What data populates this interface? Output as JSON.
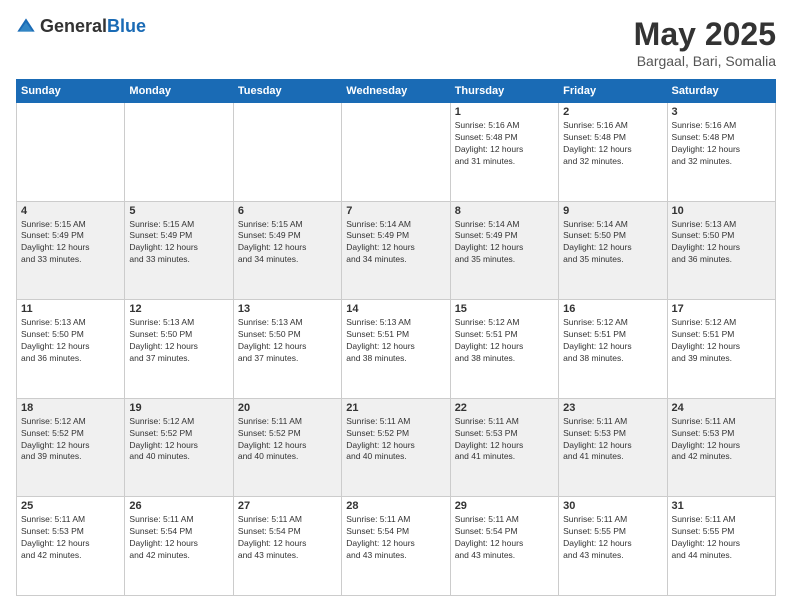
{
  "header": {
    "logo": {
      "general": "General",
      "blue": "Blue"
    },
    "title": "May 2025",
    "location": "Bargaal, Bari, Somalia"
  },
  "calendar": {
    "days_of_week": [
      "Sunday",
      "Monday",
      "Tuesday",
      "Wednesday",
      "Thursday",
      "Friday",
      "Saturday"
    ],
    "weeks": [
      {
        "row_class": "row-odd",
        "days": [
          {
            "number": "",
            "text": ""
          },
          {
            "number": "",
            "text": ""
          },
          {
            "number": "",
            "text": ""
          },
          {
            "number": "",
            "text": ""
          },
          {
            "number": "1",
            "text": "Sunrise: 5:16 AM\nSunset: 5:48 PM\nDaylight: 12 hours\nand 31 minutes."
          },
          {
            "number": "2",
            "text": "Sunrise: 5:16 AM\nSunset: 5:48 PM\nDaylight: 12 hours\nand 32 minutes."
          },
          {
            "number": "3",
            "text": "Sunrise: 5:16 AM\nSunset: 5:48 PM\nDaylight: 12 hours\nand 32 minutes."
          }
        ]
      },
      {
        "row_class": "row-even",
        "days": [
          {
            "number": "4",
            "text": "Sunrise: 5:15 AM\nSunset: 5:49 PM\nDaylight: 12 hours\nand 33 minutes."
          },
          {
            "number": "5",
            "text": "Sunrise: 5:15 AM\nSunset: 5:49 PM\nDaylight: 12 hours\nand 33 minutes."
          },
          {
            "number": "6",
            "text": "Sunrise: 5:15 AM\nSunset: 5:49 PM\nDaylight: 12 hours\nand 34 minutes."
          },
          {
            "number": "7",
            "text": "Sunrise: 5:14 AM\nSunset: 5:49 PM\nDaylight: 12 hours\nand 34 minutes."
          },
          {
            "number": "8",
            "text": "Sunrise: 5:14 AM\nSunset: 5:49 PM\nDaylight: 12 hours\nand 35 minutes."
          },
          {
            "number": "9",
            "text": "Sunrise: 5:14 AM\nSunset: 5:50 PM\nDaylight: 12 hours\nand 35 minutes."
          },
          {
            "number": "10",
            "text": "Sunrise: 5:13 AM\nSunset: 5:50 PM\nDaylight: 12 hours\nand 36 minutes."
          }
        ]
      },
      {
        "row_class": "row-odd",
        "days": [
          {
            "number": "11",
            "text": "Sunrise: 5:13 AM\nSunset: 5:50 PM\nDaylight: 12 hours\nand 36 minutes."
          },
          {
            "number": "12",
            "text": "Sunrise: 5:13 AM\nSunset: 5:50 PM\nDaylight: 12 hours\nand 37 minutes."
          },
          {
            "number": "13",
            "text": "Sunrise: 5:13 AM\nSunset: 5:50 PM\nDaylight: 12 hours\nand 37 minutes."
          },
          {
            "number": "14",
            "text": "Sunrise: 5:13 AM\nSunset: 5:51 PM\nDaylight: 12 hours\nand 38 minutes."
          },
          {
            "number": "15",
            "text": "Sunrise: 5:12 AM\nSunset: 5:51 PM\nDaylight: 12 hours\nand 38 minutes."
          },
          {
            "number": "16",
            "text": "Sunrise: 5:12 AM\nSunset: 5:51 PM\nDaylight: 12 hours\nand 38 minutes."
          },
          {
            "number": "17",
            "text": "Sunrise: 5:12 AM\nSunset: 5:51 PM\nDaylight: 12 hours\nand 39 minutes."
          }
        ]
      },
      {
        "row_class": "row-even",
        "days": [
          {
            "number": "18",
            "text": "Sunrise: 5:12 AM\nSunset: 5:52 PM\nDaylight: 12 hours\nand 39 minutes."
          },
          {
            "number": "19",
            "text": "Sunrise: 5:12 AM\nSunset: 5:52 PM\nDaylight: 12 hours\nand 40 minutes."
          },
          {
            "number": "20",
            "text": "Sunrise: 5:11 AM\nSunset: 5:52 PM\nDaylight: 12 hours\nand 40 minutes."
          },
          {
            "number": "21",
            "text": "Sunrise: 5:11 AM\nSunset: 5:52 PM\nDaylight: 12 hours\nand 40 minutes."
          },
          {
            "number": "22",
            "text": "Sunrise: 5:11 AM\nSunset: 5:53 PM\nDaylight: 12 hours\nand 41 minutes."
          },
          {
            "number": "23",
            "text": "Sunrise: 5:11 AM\nSunset: 5:53 PM\nDaylight: 12 hours\nand 41 minutes."
          },
          {
            "number": "24",
            "text": "Sunrise: 5:11 AM\nSunset: 5:53 PM\nDaylight: 12 hours\nand 42 minutes."
          }
        ]
      },
      {
        "row_class": "row-odd",
        "days": [
          {
            "number": "25",
            "text": "Sunrise: 5:11 AM\nSunset: 5:53 PM\nDaylight: 12 hours\nand 42 minutes."
          },
          {
            "number": "26",
            "text": "Sunrise: 5:11 AM\nSunset: 5:54 PM\nDaylight: 12 hours\nand 42 minutes."
          },
          {
            "number": "27",
            "text": "Sunrise: 5:11 AM\nSunset: 5:54 PM\nDaylight: 12 hours\nand 43 minutes."
          },
          {
            "number": "28",
            "text": "Sunrise: 5:11 AM\nSunset: 5:54 PM\nDaylight: 12 hours\nand 43 minutes."
          },
          {
            "number": "29",
            "text": "Sunrise: 5:11 AM\nSunset: 5:54 PM\nDaylight: 12 hours\nand 43 minutes."
          },
          {
            "number": "30",
            "text": "Sunrise: 5:11 AM\nSunset: 5:55 PM\nDaylight: 12 hours\nand 43 minutes."
          },
          {
            "number": "31",
            "text": "Sunrise: 5:11 AM\nSunset: 5:55 PM\nDaylight: 12 hours\nand 44 minutes."
          }
        ]
      }
    ]
  }
}
